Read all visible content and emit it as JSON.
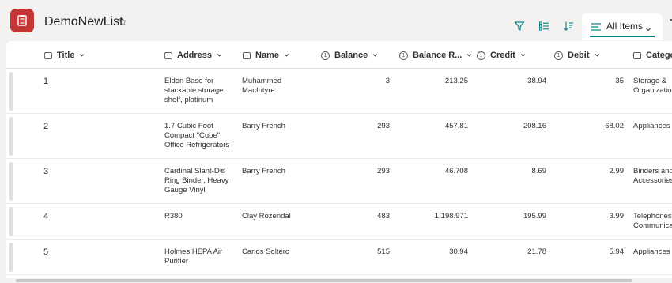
{
  "header": {
    "list_title": "DemoNewList",
    "view_name": "All Items"
  },
  "columns": [
    {
      "label": "Title",
      "icon": "text-field-icon"
    },
    {
      "label": "Address",
      "icon": "text-field-icon"
    },
    {
      "label": "Name",
      "icon": "text-field-icon"
    },
    {
      "label": "Balance",
      "icon": "number-field-icon"
    },
    {
      "label": "Balance R...",
      "icon": "number-field-icon"
    },
    {
      "label": "Credit",
      "icon": "number-field-icon"
    },
    {
      "label": "Debit",
      "icon": "number-field-icon"
    },
    {
      "label": "Categor",
      "icon": "text-field-icon"
    }
  ],
  "rows": [
    {
      "title": "1",
      "address": "Eldon Base for stackable storage shelf, platinum",
      "name": "Muhammed MacIntyre",
      "balance": "3",
      "balance_r": "-213.25",
      "credit": "38.94",
      "debit": "35",
      "category": "Storage &\nOrganizatio"
    },
    {
      "title": "2",
      "address": "1.7 Cubic Foot Compact \"Cube\" Office Refrigerators",
      "name": "Barry French",
      "balance": "293",
      "balance_r": "457.81",
      "credit": "208.16",
      "debit": "68.02",
      "category": "Appliances"
    },
    {
      "title": "3",
      "address": "Cardinal Slant-D® Ring Binder, Heavy Gauge Vinyl",
      "name": "Barry French",
      "balance": "293",
      "balance_r": "46.708",
      "credit": "8.69",
      "debit": "2.99",
      "category": "Binders and\nAccessories"
    },
    {
      "title": "4",
      "address": "R380",
      "name": "Clay Rozendal",
      "balance": "483",
      "balance_r": "1,198.971",
      "credit": "195.99",
      "debit": "3.99",
      "category": "Telephones a\nCommunica"
    },
    {
      "title": "5",
      "address": "Holmes HEPA Air Purifier",
      "name": "Carlos Soltero",
      "balance": "515",
      "balance_r": "30.94",
      "credit": "21.78",
      "debit": "5.94",
      "category": "Appliances"
    }
  ],
  "colors": {
    "app_icon": "#c43535",
    "accent": "#038387"
  }
}
